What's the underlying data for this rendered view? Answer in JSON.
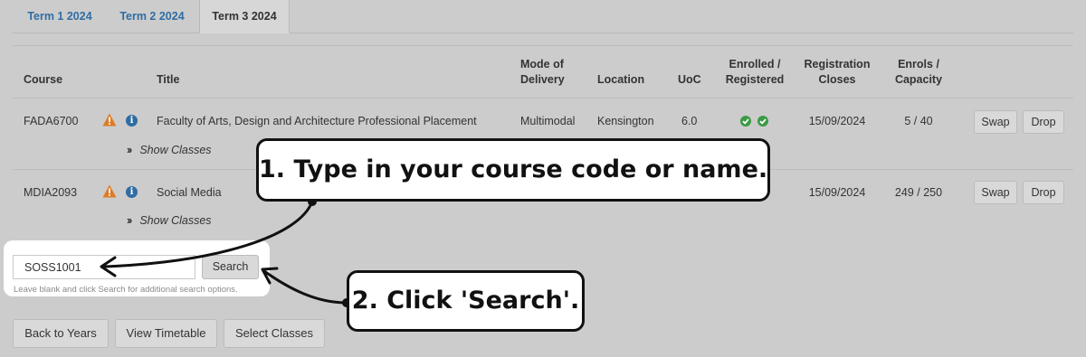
{
  "tabs": [
    {
      "label": "Term 1 2024",
      "active": false
    },
    {
      "label": "Term 2 2024",
      "active": false
    },
    {
      "label": "Term 3 2024",
      "active": true
    }
  ],
  "table": {
    "headers": {
      "course": "Course",
      "title": "Title",
      "mode_line1": "Mode of",
      "mode_line2": "Delivery",
      "location": "Location",
      "uoc": "UoC",
      "enrolled_line1": "Enrolled /",
      "enrolled_line2": "Registered",
      "registration_line1": "Registration",
      "registration_line2": "Closes",
      "enrols_line1": "Enrols /",
      "enrols_line2": "Capacity"
    },
    "rows": [
      {
        "course": "FADA6700",
        "title": "Faculty of Arts, Design and Architecture Professional Placement",
        "mode": "Multimodal",
        "location": "Kensington",
        "uoc": "6.0",
        "registration_closes": "15/09/2024",
        "enrols_capacity": "5 / 40",
        "show_classes": "Show Classes",
        "swap": "Swap",
        "drop": "Drop"
      },
      {
        "course": "MDIA2093",
        "title": "Social Media",
        "registration_closes": "15/09/2024",
        "enrols_capacity": "249 / 250",
        "show_classes": "Show Classes",
        "swap": "Swap",
        "drop": "Drop"
      }
    ]
  },
  "search": {
    "value": "SOSS1001",
    "button": "Search",
    "hint": "Leave blank and click Search for additional search options."
  },
  "footer_buttons": {
    "back": "Back to Years",
    "timetable": "View Timetable",
    "select": "Select Classes"
  },
  "callouts": {
    "step1": "1. Type in your course code or name.",
    "step2": "2. Click 'Search'."
  },
  "colors": {
    "background": "#cccccc",
    "tab_link": "#2f6da3",
    "warning": "#e07b24",
    "info": "#2f6da3",
    "check": "#3b9a45"
  },
  "icons": {
    "warning": "warning-icon",
    "info": "info-icon",
    "check": "check-circle-icon",
    "chevron": "double-chevron-right-icon"
  }
}
